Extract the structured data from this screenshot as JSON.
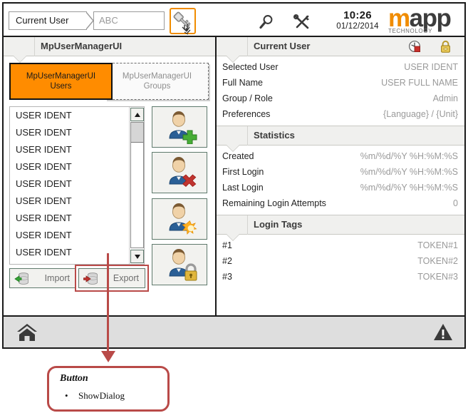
{
  "topbar": {
    "current_user_label": "Current User",
    "current_user_value": "ABC",
    "key_icon": "key-icon",
    "cursor_icon": "hand-cursor-icon",
    "search_icon": "search-icon",
    "tools_icon": "tools-icon",
    "time": "10:26",
    "date": "01/12/2014",
    "logo_m": "m",
    "logo_app": "app",
    "logo_sub": "TECHNOLOGY"
  },
  "left_panel": {
    "header_title": "MpUserManagerUI",
    "tabs": [
      {
        "label": "MpUserManagerUI\nUsers",
        "line1": "MpUserManagerUI",
        "line2": "Users",
        "active": true
      },
      {
        "label": "MpUserManagerUI\nGroups",
        "line1": "MpUserManagerUI",
        "line2": "Groups",
        "active": false
      }
    ],
    "user_list": [
      "USER IDENT",
      "USER IDENT",
      "USER IDENT",
      "USER IDENT",
      "USER IDENT",
      "USER IDENT",
      "USER IDENT",
      "USER IDENT",
      "USER IDENT"
    ],
    "scroll_up_icon": "scroll-up-arrow-icon",
    "scroll_down_icon": "scroll-down-arrow-icon",
    "import_label": "Import",
    "export_label": "Export",
    "import_icon": "database-import-icon",
    "export_icon": "database-export-icon",
    "action_buttons": [
      {
        "name": "add-user-button",
        "icon": "user-add-icon"
      },
      {
        "name": "delete-user-button",
        "icon": "user-delete-icon"
      },
      {
        "name": "reset-user-button",
        "icon": "user-reset-icon"
      },
      {
        "name": "lock-user-button",
        "icon": "user-lock-icon"
      }
    ]
  },
  "right_panel": {
    "header_title": "Current User",
    "header_icons": [
      "clock-icon",
      "padlock-icon"
    ],
    "details": [
      {
        "key": "Selected User",
        "value": "USER IDENT"
      },
      {
        "key": "Full Name",
        "value": "USER FULL NAME"
      },
      {
        "key": "Group / Role",
        "value": "Admin"
      },
      {
        "key": "Preferences",
        "value": "{Language} / {Unit}"
      }
    ],
    "statistics_title": "Statistics",
    "statistics": [
      {
        "key": "Created",
        "value": "%m/%d/%Y %H:%M:%S"
      },
      {
        "key": "First Login",
        "value": "%m/%d/%Y %H:%M:%S"
      },
      {
        "key": "Last Login",
        "value": "%m/%d/%Y %H:%M:%S"
      },
      {
        "key": "Remaining Login Attempts",
        "value": "0"
      }
    ],
    "login_tags_title": "Login Tags",
    "login_tags": [
      {
        "key": "#1",
        "value": "TOKEN#1"
      },
      {
        "key": "#2",
        "value": "TOKEN#2"
      },
      {
        "key": "#3",
        "value": "TOKEN#3"
      }
    ]
  },
  "statusbar": {
    "home_icon": "home-icon",
    "warning_icon": "warning-icon"
  },
  "annotation": {
    "title": "Button",
    "bullet": "ShowDialog",
    "target": "export-button",
    "color": "#b94a48"
  },
  "colors": {
    "accent_orange": "#FF8C00",
    "logo_orange": "#f08c00",
    "annotation_red": "#b94a48",
    "panel_header_grey": "#f0f0ee",
    "statusbar_grey": "#dedede",
    "value_grey": "#9a9a9a"
  }
}
